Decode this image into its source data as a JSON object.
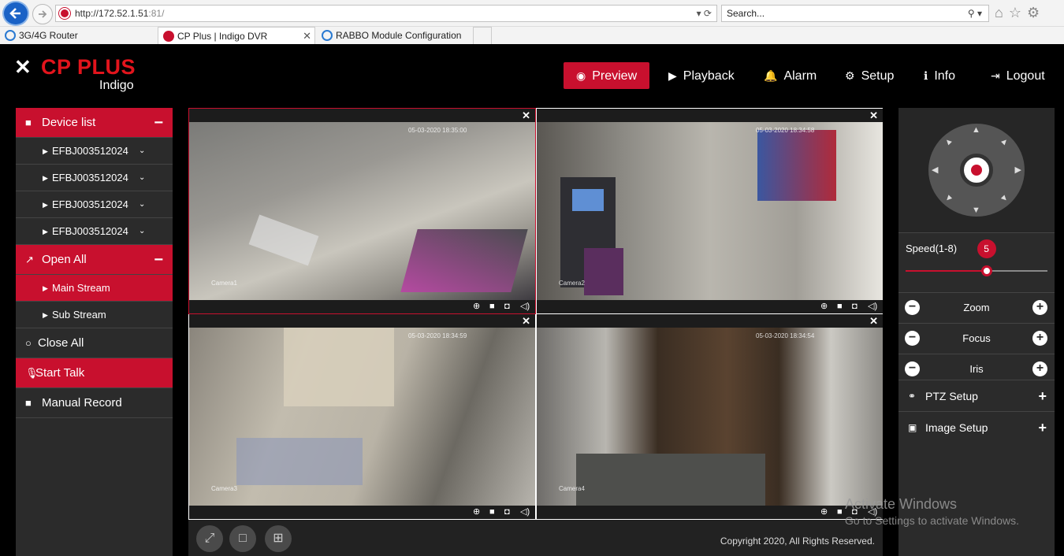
{
  "browser": {
    "url_host": "http://172.52.1.51",
    "url_port": ":81/",
    "search_placeholder": "Search...",
    "tabs": [
      {
        "label": "3G/4G Router"
      },
      {
        "label": "CP Plus | Indigo DVR"
      },
      {
        "label": "RABBO Module Configuration"
      }
    ]
  },
  "brand": {
    "name": "CP PLUS",
    "sub": "Indigo",
    "mark": "✕"
  },
  "nav": [
    {
      "label": "Preview",
      "icon": "eye-icon"
    },
    {
      "label": "Playback",
      "icon": "play-circle-icon"
    },
    {
      "label": "Alarm",
      "icon": "bell-icon"
    },
    {
      "label": "Setup",
      "icon": "gear-icon"
    },
    {
      "label": "Info",
      "icon": "info-icon"
    },
    {
      "label": "Logout",
      "icon": "logout-icon"
    }
  ],
  "sidebar": {
    "device_list": "Device list",
    "devices": [
      "EFBJ003512024",
      "EFBJ003512024",
      "EFBJ003512024",
      "EFBJ003512024"
    ],
    "open_all": "Open All",
    "main_stream": "Main Stream",
    "sub_stream": "Sub Stream",
    "close_all": "Close All",
    "start_talk": "Start Talk",
    "manual_record": "Manual Record"
  },
  "cameras": [
    {
      "timestamp": "05-03-2020 18:35:00",
      "tag": "Camera1"
    },
    {
      "timestamp": "05-03-2020 18:34:58",
      "tag": "Camera2"
    },
    {
      "timestamp": "05-03-2020 18:34:59",
      "tag": "Camera3"
    },
    {
      "timestamp": "05-03-2020 18:34:54",
      "tag": "Camera4"
    }
  ],
  "footer": {
    "copyright": "Copyright 2020, All Rights Reserved."
  },
  "ptz": {
    "speed_label": "Speed(1-8)",
    "speed_value": "5",
    "speed_fraction": 0.57,
    "zoom": "Zoom",
    "focus": "Focus",
    "iris": "Iris",
    "ptz_setup": "PTZ Setup",
    "image_setup": "Image Setup"
  },
  "watermark": {
    "line1": "Activate Windows",
    "line2": "Go to Settings to activate Windows."
  },
  "colors": {
    "accent": "#c8102e",
    "panel": "#2b2b2b",
    "background": "#000000"
  }
}
